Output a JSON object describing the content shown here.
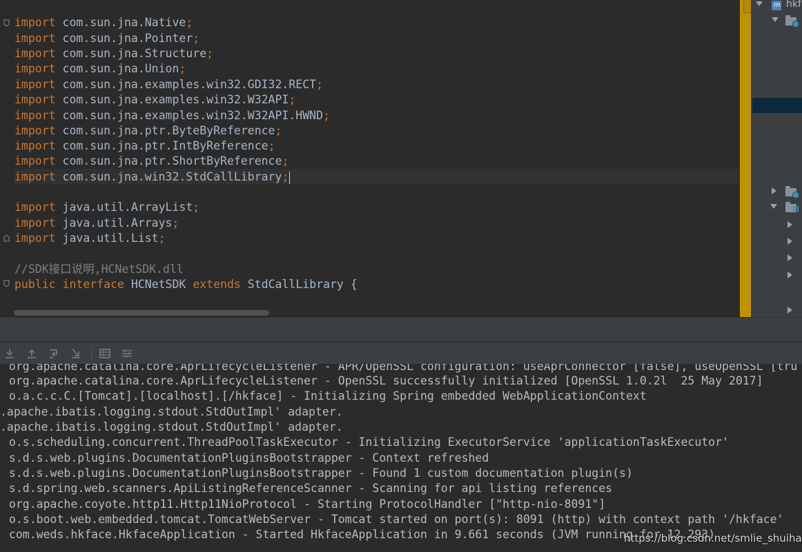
{
  "editor": {
    "imports_jna": [
      {
        "keyword": "import",
        "package": "com.sun.jna.Native",
        "semi": ";"
      },
      {
        "keyword": "import",
        "package": "com.sun.jna.Pointer",
        "semi": ";"
      },
      {
        "keyword": "import",
        "package": "com.sun.jna.Structure",
        "semi": ";"
      },
      {
        "keyword": "import",
        "package": "com.sun.jna.Union",
        "semi": ";"
      },
      {
        "keyword": "import",
        "package": "com.sun.jna.examples.win32.GDI32.RECT",
        "semi": ";"
      },
      {
        "keyword": "import",
        "package": "com.sun.jna.examples.win32.W32API",
        "semi": ";"
      },
      {
        "keyword": "import",
        "package": "com.sun.jna.examples.win32.W32API.HWND",
        "semi": ";"
      },
      {
        "keyword": "import",
        "package": "com.sun.jna.ptr.ByteByReference",
        "semi": ";"
      },
      {
        "keyword": "import",
        "package": "com.sun.jna.ptr.IntByReference",
        "semi": ";"
      },
      {
        "keyword": "import",
        "package": "com.sun.jna.ptr.ShortByReference",
        "semi": ";"
      },
      {
        "keyword": "import",
        "package": "com.sun.jna.win32.StdCallLibrary",
        "semi": ";"
      }
    ],
    "imports_util": [
      {
        "keyword": "import",
        "package": "java.util.ArrayList",
        "semi": ";"
      },
      {
        "keyword": "import",
        "package": "java.util.Arrays",
        "semi": ";"
      },
      {
        "keyword": "import",
        "package": "java.util.List",
        "semi": ";"
      }
    ],
    "comment": "//SDK接口说明,HCNetSDK.dll",
    "decl": {
      "kw_public": "public",
      "kw_interface": "interface",
      "name": "HCNetSDK",
      "kw_extends": "extends",
      "parent": "StdCallLibrary",
      "brace": "{"
    }
  },
  "project_panel": {
    "root_label": "hkf",
    "icons": [
      "module-icon",
      "config-folder-icon",
      "config-folder-icon",
      "resources-folder-icon"
    ]
  },
  "console_toolbar": {
    "icons": [
      "download-icon",
      "upload-icon",
      "soft-wrap-icon",
      "scroll-to-end-icon",
      "print-icon",
      "settings-icon"
    ]
  },
  "console": {
    "lines": [
      " org.apache.catalina.core.AprLifecycleListener - APR/OpenSSL configuration: useAprConnector [false], useOpenSSL [tru",
      " org.apache.catalina.core.AprLifecycleListener - OpenSSL successfully initialized [OpenSSL 1.0.2l  25 May 2017]",
      " o.a.c.c.C.[Tomcat].[localhost].[/hkface] - Initializing Spring embedded WebApplicationContext",
      ".apache.ibatis.logging.stdout.StdOutImpl' adapter.",
      ".apache.ibatis.logging.stdout.StdOutImpl' adapter.",
      " o.s.scheduling.concurrent.ThreadPoolTaskExecutor - Initializing ExecutorService 'applicationTaskExecutor'",
      " s.d.s.web.plugins.DocumentationPluginsBootstrapper - Context refreshed",
      " s.d.s.web.plugins.DocumentationPluginsBootstrapper - Found 1 custom documentation plugin(s)",
      " s.d.spring.web.scanners.ApiListingReferenceScanner - Scanning for api listing references",
      " org.apache.coyote.http11.Http11NioProtocol - Starting ProtocolHandler [\"http-nio-8091\"]",
      " o.s.boot.web.embedded.tomcat.TomcatWebServer - Tomcat started on port(s): 8091 (http) with context path '/hkface'",
      " com.weds.hkface.HkfaceApplication - Started HkfaceApplication in 9.661 seconds (JVM running for 12.293)"
    ]
  },
  "watermark": "https://blog.csdn.net/smlie_shuihan",
  "colors": {
    "editor_bg": "#2b2b2b",
    "keyword": "#cc7832",
    "identifier": "#a9b7c6",
    "comment": "#808080",
    "console_text": "#bbbbbb",
    "panel_bg": "#3c3f41",
    "marker_stripe": "#c19200",
    "selection": "#0d293e"
  }
}
